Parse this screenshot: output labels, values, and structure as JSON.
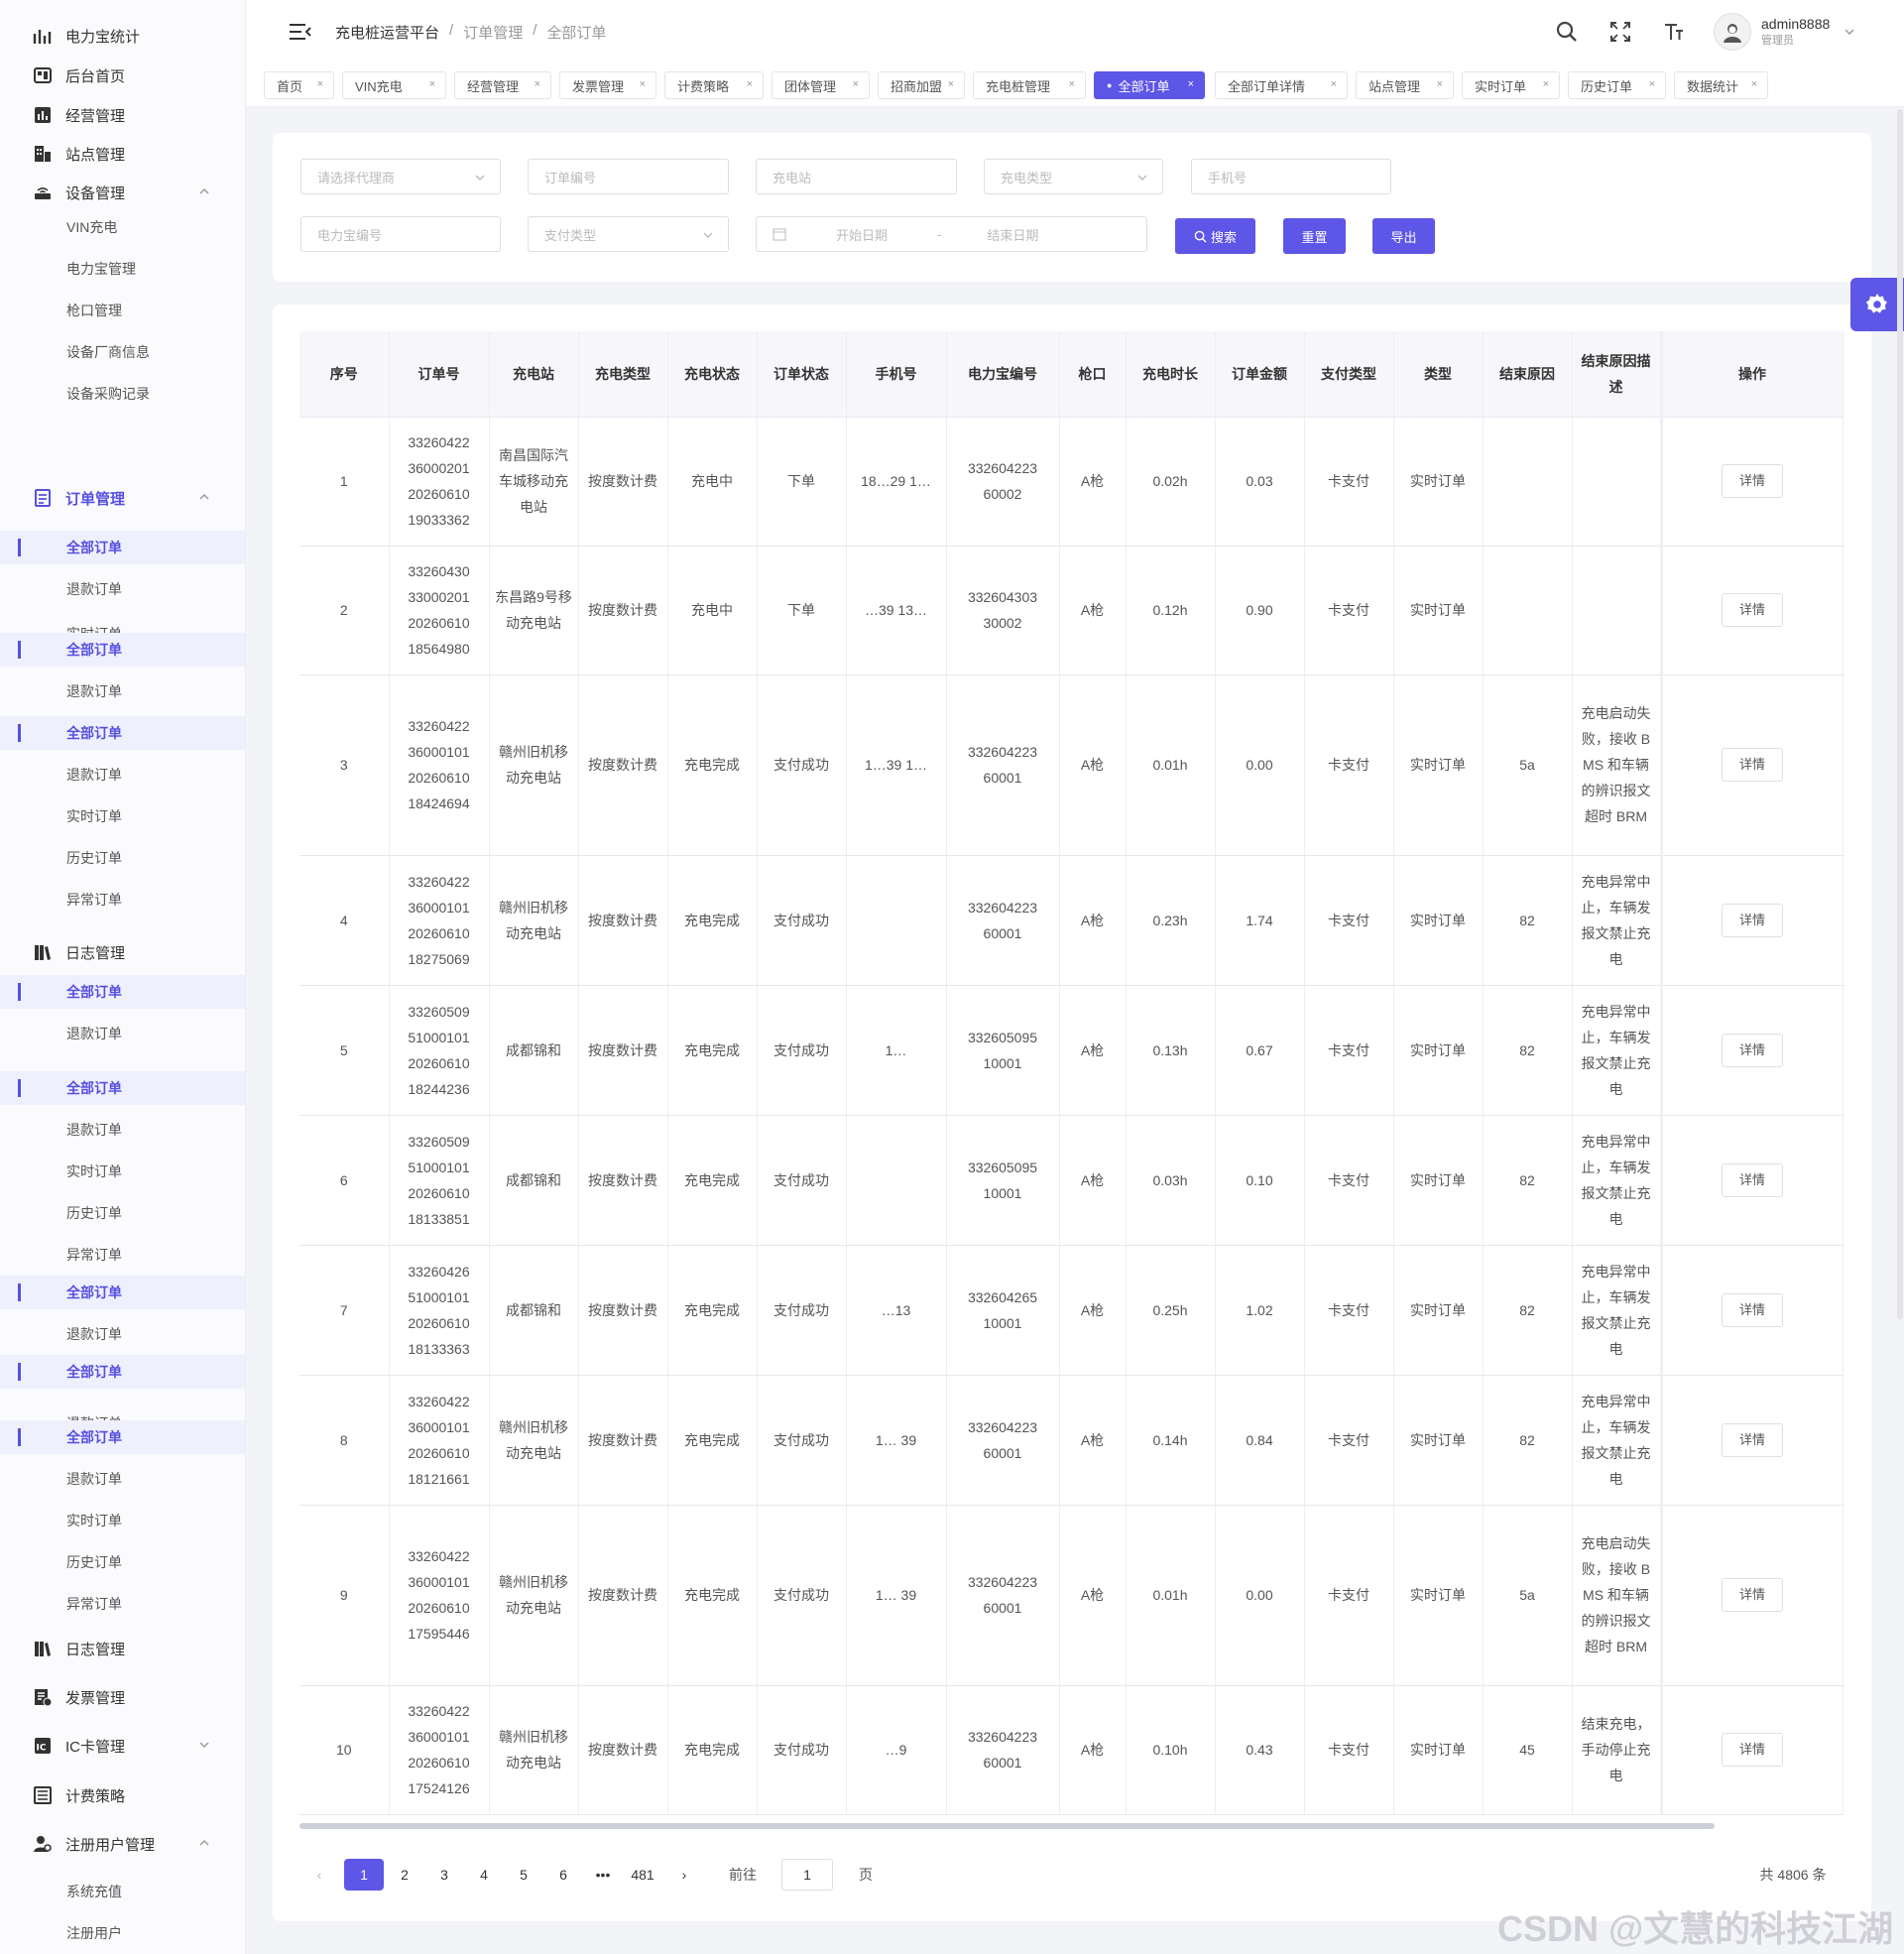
{
  "sidebar": {
    "items": [
      {
        "label": "电力宝统计",
        "icon": "chart-icon"
      },
      {
        "label": "后台首页",
        "icon": "dashboard-icon"
      },
      {
        "label": "经营管理",
        "icon": "bar-chart-icon"
      },
      {
        "label": "站点管理",
        "icon": "building-icon"
      },
      {
        "label": "设备管理",
        "icon": "router-icon"
      },
      {
        "label": "订单管理",
        "icon": "order-list-icon"
      },
      {
        "label": "日志管理",
        "icon": "books-icon"
      },
      {
        "label": "日志管理",
        "icon": "books-icon"
      },
      {
        "label": "发票管理",
        "icon": "invoice-icon"
      },
      {
        "label": "IC卡管理",
        "icon": "ic-card-icon"
      },
      {
        "label": "计费策略",
        "icon": "list-icon"
      },
      {
        "label": "注册用户管理",
        "icon": "user-settings-icon"
      }
    ],
    "device_sub": [
      "VIN充电",
      "电力宝管理",
      "枪口管理",
      "设备厂商信息",
      "设备采购记录"
    ],
    "order_subs": [
      "全部订单",
      "退款订单",
      "实时订单",
      "全部订单",
      "退款订单",
      "全部订单",
      "退款订单",
      "实时订单",
      "历史订单",
      "异常订单",
      "全部订单",
      "退款订单",
      "实时订单",
      "全部订单",
      "退款订单",
      "实时订单",
      "历史订单",
      "异常订单",
      "全部订单",
      "退款订单",
      "全部订单",
      "退款订单",
      "全部订单",
      "退款订单",
      "实时订单",
      "历史订单",
      "异常订单"
    ],
    "user_sub": [
      "系统充值",
      "注册用户"
    ]
  },
  "header": {
    "breadcrumb": [
      "充电桩运营平台",
      "/",
      "订单管理",
      "/",
      "全部订单"
    ],
    "username": "admin8888",
    "role": "管理员"
  },
  "tabs": [
    "首页",
    "VIN充电",
    "经营管理",
    "发票管理",
    "计费策略",
    "团体管理",
    "招商加盟",
    "充电桩管理",
    "全部订单",
    "全部订单详情",
    "站点管理",
    "实时订单",
    "历史订单",
    "数据统计"
  ],
  "filters": {
    "agent": "请选择代理商",
    "order_no": "订单编号",
    "station": "充电站",
    "charge_type": "充电类型",
    "phone": "手机号",
    "power_no": "电力宝编号",
    "pay_type": "支付类型",
    "start_date": "开始日期",
    "date_sep": "-",
    "end_date": "结束日期",
    "search": "搜索",
    "reset": "重置",
    "export": "导出"
  },
  "table": {
    "headers": [
      "序号",
      "订单号",
      "充电站",
      "充电类型",
      "充电状态",
      "订单状态",
      "手机号",
      "电力宝编号",
      "枪口",
      "充电时长",
      "订单金额",
      "支付类型",
      "类型",
      "结束原因",
      "结束原因描述",
      "操作"
    ],
    "detail_label": "详情",
    "rows": [
      {
        "no": "1",
        "order": "33260422360002012026061019033362",
        "station": "南昌国际汽车城移动充电站",
        "ctype": "按度数计费",
        "cstatus": "充电中",
        "ostatus": "下单",
        "phone": "18…29 1…",
        "power": "33260422360002",
        "gun": "A枪",
        "dur": "0.02h",
        "amt": "0.03",
        "pay": "卡支付",
        "kind": "实时订单",
        "reason": "",
        "desc": "",
        "h": 130
      },
      {
        "no": "2",
        "order": "33260430330002012026061018564980",
        "station": "东昌路9号移动充电站",
        "ctype": "按度数计费",
        "cstatus": "充电中",
        "ostatus": "下单",
        "phone": "…39 13…",
        "power": "33260430330002",
        "gun": "A枪",
        "dur": "0.12h",
        "amt": "0.90",
        "pay": "卡支付",
        "kind": "实时订单",
        "reason": "",
        "desc": "",
        "h": 130
      },
      {
        "no": "3",
        "order": "33260422360001012026061018424694",
        "station": "赣州旧机移动充电站",
        "ctype": "按度数计费",
        "cstatus": "充电完成",
        "ostatus": "支付成功",
        "phone": "1…39 1…",
        "power": "33260422360001",
        "gun": "A枪",
        "dur": "0.01h",
        "amt": "0.00",
        "pay": "卡支付",
        "kind": "实时订单",
        "reason": "5a",
        "desc": "充电启动失败，接收 BMS 和车辆的辨识报文超时 BRM",
        "h": 182
      },
      {
        "no": "4",
        "order": "33260422360001012026061018275069",
        "station": "赣州旧机移动充电站",
        "ctype": "按度数计费",
        "cstatus": "充电完成",
        "ostatus": "支付成功",
        "phone": "",
        "power": "33260422360001",
        "gun": "A枪",
        "dur": "0.23h",
        "amt": "1.74",
        "pay": "卡支付",
        "kind": "实时订单",
        "reason": "82",
        "desc": "充电异常中止，车辆发报文禁止充电",
        "h": 131
      },
      {
        "no": "5",
        "order": "33260509510001012026061018244236",
        "station": "成都锦和",
        "ctype": "按度数计费",
        "cstatus": "充电完成",
        "ostatus": "支付成功",
        "phone": "1…",
        "power": "33260509510001",
        "gun": "A枪",
        "dur": "0.13h",
        "amt": "0.67",
        "pay": "卡支付",
        "kind": "实时订单",
        "reason": "82",
        "desc": "充电异常中止，车辆发报文禁止充电",
        "h": 131
      },
      {
        "no": "6",
        "order": "33260509510001012026061018133851",
        "station": "成都锦和",
        "ctype": "按度数计费",
        "cstatus": "充电完成",
        "ostatus": "支付成功",
        "phone": "",
        "power": "33260509510001",
        "gun": "A枪",
        "dur": "0.03h",
        "amt": "0.10",
        "pay": "卡支付",
        "kind": "实时订单",
        "reason": "82",
        "desc": "充电异常中止，车辆发报文禁止充电",
        "h": 131
      },
      {
        "no": "7",
        "order": "33260426510001012026061018133363",
        "station": "成都锦和",
        "ctype": "按度数计费",
        "cstatus": "充电完成",
        "ostatus": "支付成功",
        "phone": "…13",
        "power": "33260426510001",
        "gun": "A枪",
        "dur": "0.25h",
        "amt": "1.02",
        "pay": "卡支付",
        "kind": "实时订单",
        "reason": "82",
        "desc": "充电异常中止，车辆发报文禁止充电",
        "h": 131
      },
      {
        "no": "8",
        "order": "33260422360001012026061018121661",
        "station": "赣州旧机移动充电站",
        "ctype": "按度数计费",
        "cstatus": "充电完成",
        "ostatus": "支付成功",
        "phone": "1… 39",
        "power": "33260422360001",
        "gun": "A枪",
        "dur": "0.14h",
        "amt": "0.84",
        "pay": "卡支付",
        "kind": "实时订单",
        "reason": "82",
        "desc": "充电异常中止，车辆发报文禁止充电",
        "h": 131
      },
      {
        "no": "9",
        "order": "33260422360001012026061017595446",
        "station": "赣州旧机移动充电站",
        "ctype": "按度数计费",
        "cstatus": "充电完成",
        "ostatus": "支付成功",
        "phone": "1… 39",
        "power": "33260422360001",
        "gun": "A枪",
        "dur": "0.01h",
        "amt": "0.00",
        "pay": "卡支付",
        "kind": "实时订单",
        "reason": "5a",
        "desc": "充电启动失败，接收 BMS 和车辆的辨识报文超时 BRM",
        "h": 182
      },
      {
        "no": "10",
        "order": "33260422360001012026061017524126",
        "station": "赣州旧机移动充电站",
        "ctype": "按度数计费",
        "cstatus": "充电完成",
        "ostatus": "支付成功",
        "phone": "…9",
        "power": "33260422360001",
        "gun": "A枪",
        "dur": "0.10h",
        "amt": "0.43",
        "pay": "卡支付",
        "kind": "实时订单",
        "reason": "45",
        "desc": "结束充电，手动停止充电",
        "h": 130
      }
    ]
  },
  "pagination": {
    "prev": "‹",
    "pages": [
      "1",
      "2",
      "3",
      "4",
      "5",
      "6",
      "•••",
      "481"
    ],
    "next": "›",
    "goto_label": "前往",
    "goto_value": "1",
    "page_unit": "页",
    "total": "共 4806 条"
  },
  "watermark": "CSDN @文慧的科技江湖",
  "colors": {
    "accent": "#5e56e6",
    "sidebar_bg": "#fbfbfe",
    "page_bg": "#f3f4f8"
  }
}
